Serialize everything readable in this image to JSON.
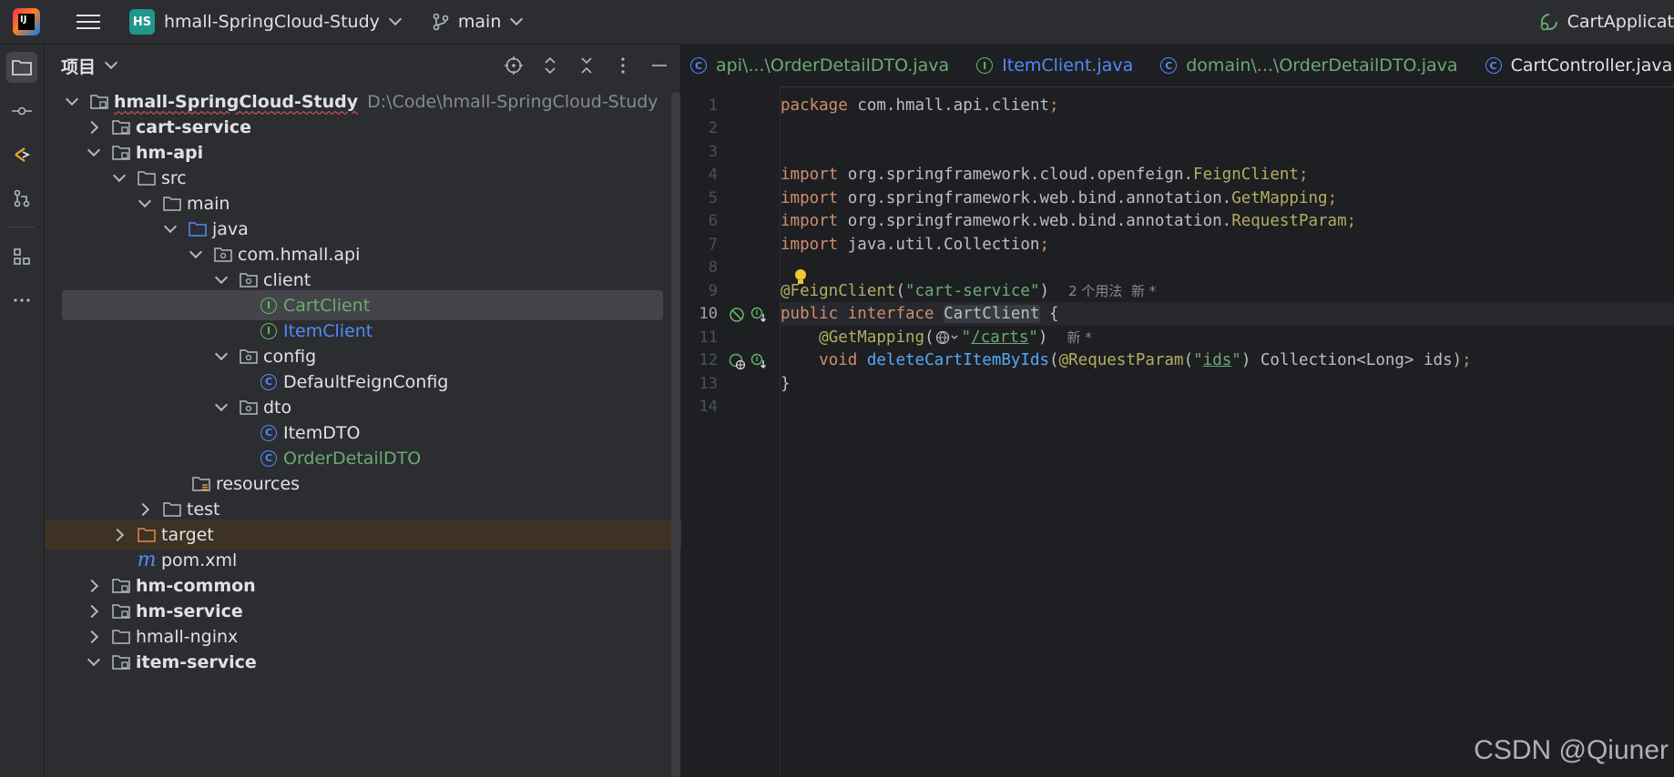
{
  "titlebar": {
    "logo_text": "IJ",
    "project_badge": "HS",
    "project_name": "hmall-SpringCloud-Study",
    "branch": "main",
    "run_config": "CartApplicat"
  },
  "project_panel": {
    "title": "项目",
    "tree": [
      {
        "label": "hmall-SpringCloud-Study",
        "hint": "D:\\Code\\hmall-SpringCloud-Study"
      },
      {
        "label": "cart-service"
      },
      {
        "label": "hm-api"
      },
      {
        "label": "src"
      },
      {
        "label": "main"
      },
      {
        "label": "java"
      },
      {
        "label": "com.hmall.api"
      },
      {
        "label": "client"
      },
      {
        "label": "CartClient"
      },
      {
        "label": "ItemClient"
      },
      {
        "label": "config"
      },
      {
        "label": "DefaultFeignConfig"
      },
      {
        "label": "dto"
      },
      {
        "label": "ItemDTO"
      },
      {
        "label": "OrderDetailDTO"
      },
      {
        "label": "resources"
      },
      {
        "label": "test"
      },
      {
        "label": "target"
      },
      {
        "label": "pom.xml"
      },
      {
        "label": "hm-common"
      },
      {
        "label": "hm-service"
      },
      {
        "label": "hmall-nginx"
      },
      {
        "label": "item-service"
      }
    ]
  },
  "tabs": [
    {
      "label": "api\\...\\OrderDetailDTO.java"
    },
    {
      "label": "ItemClient.java"
    },
    {
      "label": "domain\\...\\OrderDetailDTO.java"
    },
    {
      "label": "CartController.java"
    }
  ],
  "editor": {
    "line_numbers": [
      "1",
      "2",
      "3",
      "4",
      "5",
      "6",
      "7",
      "8",
      "9",
      "10",
      "11",
      "12",
      "13",
      "14"
    ],
    "l1": {
      "kw": "package",
      "rest": " com.hmall.api.client",
      "semi": ";"
    },
    "imports": [
      {
        "kw": "import",
        "pkg": " org.springframework.cloud.openfeign.",
        "cls": "FeignClient",
        "semi": ";"
      },
      {
        "kw": "import",
        "pkg": " org.springframework.web.bind.annotation.",
        "cls": "GetMapping",
        "semi": ";"
      },
      {
        "kw": "import",
        "pkg": " org.springframework.web.bind.annotation.",
        "cls": "RequestParam",
        "semi": ";"
      },
      {
        "kw": "import",
        "pkg": " java.util.Collection",
        "cls": "",
        "semi": ";"
      }
    ],
    "l9": {
      "ann": "@FeignClient",
      "open": "(",
      "str": "\"cart-service\"",
      "close": ")",
      "hint": "2 个用法  新 *"
    },
    "l10": {
      "kw1": "public",
      "kw2": "interface",
      "name": "CartClient",
      "brace": "{"
    },
    "l11": {
      "ann": "@GetMapping",
      "open": "(",
      "str_q1": "\"",
      "path": "/carts",
      "str_q2": "\"",
      "close": ")",
      "hint": "新 *"
    },
    "l12": {
      "kw": "void",
      "fn": "deleteCartItemByIds",
      "open": "(",
      "ann": "@RequestParam",
      "p1": "(",
      "q1": "\"",
      "ids": "ids",
      "q2": "\"",
      "p2": ")",
      "rest": " Collection<Long> ids)",
      "semi": ";"
    },
    "l13": "}"
  },
  "watermark": "CSDN @Qiuner",
  "colors": {
    "accent": "#3574f0",
    "keyword": "#cf8e6d",
    "annotation": "#b3ae60",
    "string": "#6aab73",
    "function": "#56a8f5"
  }
}
